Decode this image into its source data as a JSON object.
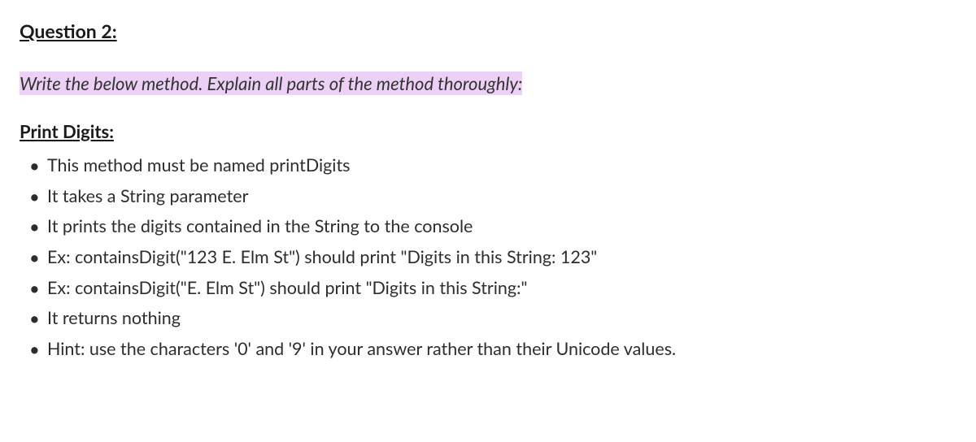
{
  "question_title": "Question 2:",
  "instruction": "Write the below method. Explain all parts of the method thoroughly:",
  "section_title": "Print Digits:",
  "bullets": [
    "This method must be named printDigits",
    "It takes a String parameter",
    "It prints the digits contained in the String to the console",
    "Ex: containsDigit(\"123 E. Elm St\")  should print \"Digits in this String: 123\"",
    "Ex: containsDigit(\"E. Elm St\") should print \"Digits in this String:\"",
    "It returns nothing",
    "Hint: use the characters '0' and '9' in your answer rather than their Unicode values."
  ]
}
